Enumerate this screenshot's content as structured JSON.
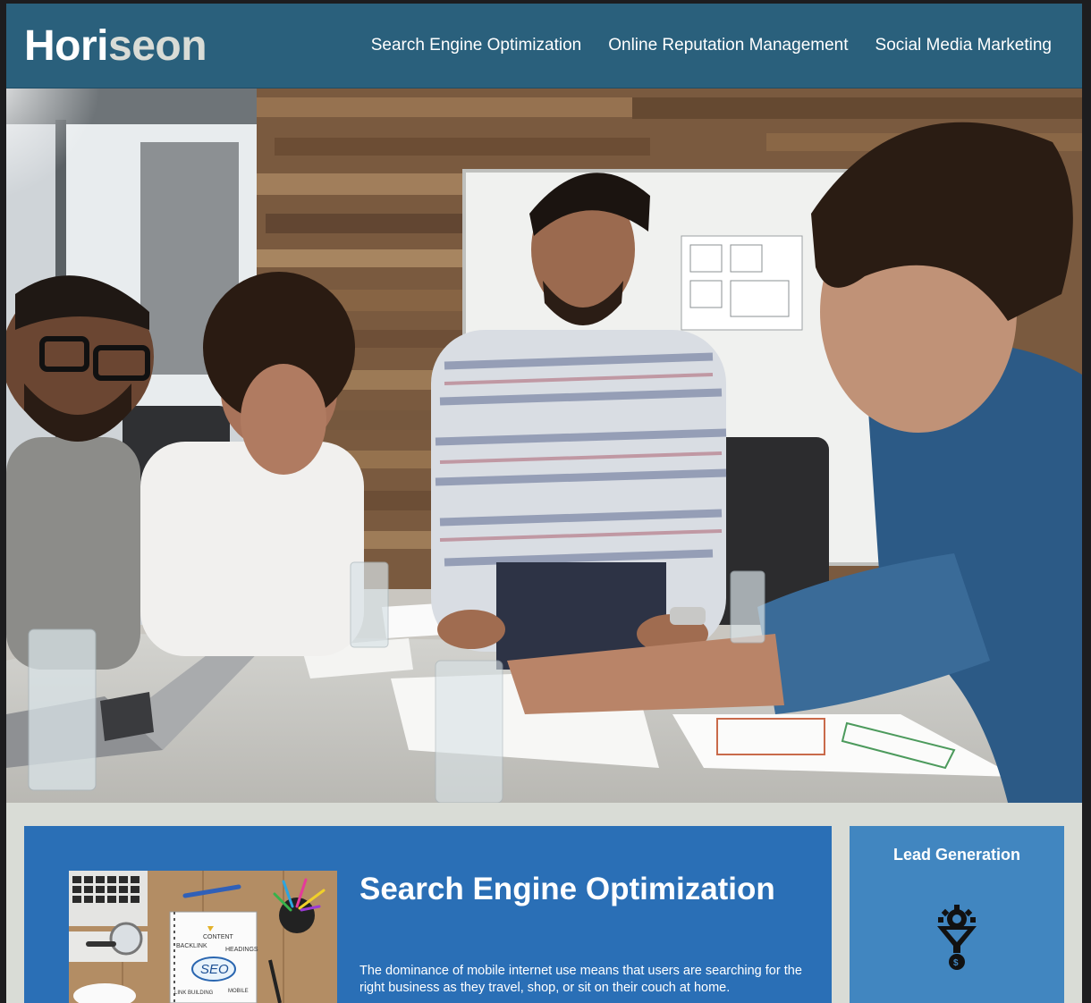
{
  "header": {
    "logo_main": "Hori",
    "logo_accent": "seon",
    "nav": [
      {
        "label": "Search Engine Optimization"
      },
      {
        "label": "Online Reputation Management"
      },
      {
        "label": "Social Media Marketing"
      }
    ]
  },
  "content": {
    "seo_title": "Search Engine Optimization",
    "seo_text": "The dominance of mobile internet use means that users are searching for the right business as they travel, shop, or sit on their couch at home.",
    "seo_image_words": [
      "CONTENT",
      "HEADINGS",
      "BACKLINK",
      "SEO",
      "LINK BUILDING",
      "MOBILE"
    ]
  },
  "sidebar": {
    "title": "Lead Generation",
    "icon": "lead-funnel-icon"
  },
  "colors": {
    "header_bg": "#2a607c",
    "content_bg": "#2a6fb6",
    "sidebar_bg": "#4186c0",
    "page_bg": "#d9dcd6"
  }
}
